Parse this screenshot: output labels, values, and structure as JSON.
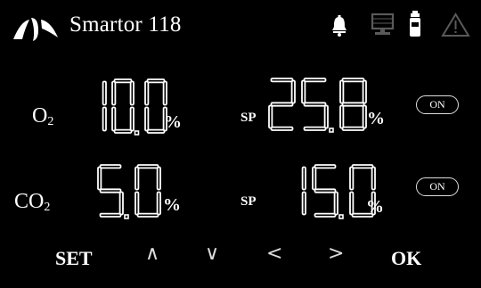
{
  "header": {
    "title": "Smartor 118",
    "icons": [
      "logo-icon",
      "bell-icon",
      "computer-icon",
      "gas-cylinder-icon",
      "warning-icon"
    ]
  },
  "rows": [
    {
      "gas": "O",
      "sub": "2",
      "value": "10.0",
      "unit": "%",
      "sp_label": "SP",
      "sp_value": "25.8",
      "sp_unit": "%",
      "toggle": "ON"
    },
    {
      "gas": "CO",
      "sub": "2",
      "value": "5.0",
      "unit": "%",
      "sp_label": "SP",
      "sp_value": "15.0",
      "sp_unit": "%",
      "toggle": "ON"
    }
  ],
  "nav": {
    "set": "SET",
    "up": "∧",
    "down": "∨",
    "left": "<",
    "right": ">",
    "ok": "OK"
  },
  "colors": {
    "background": "#000000",
    "text": "#ffffff",
    "dim_icon": "#5a5a5a"
  }
}
